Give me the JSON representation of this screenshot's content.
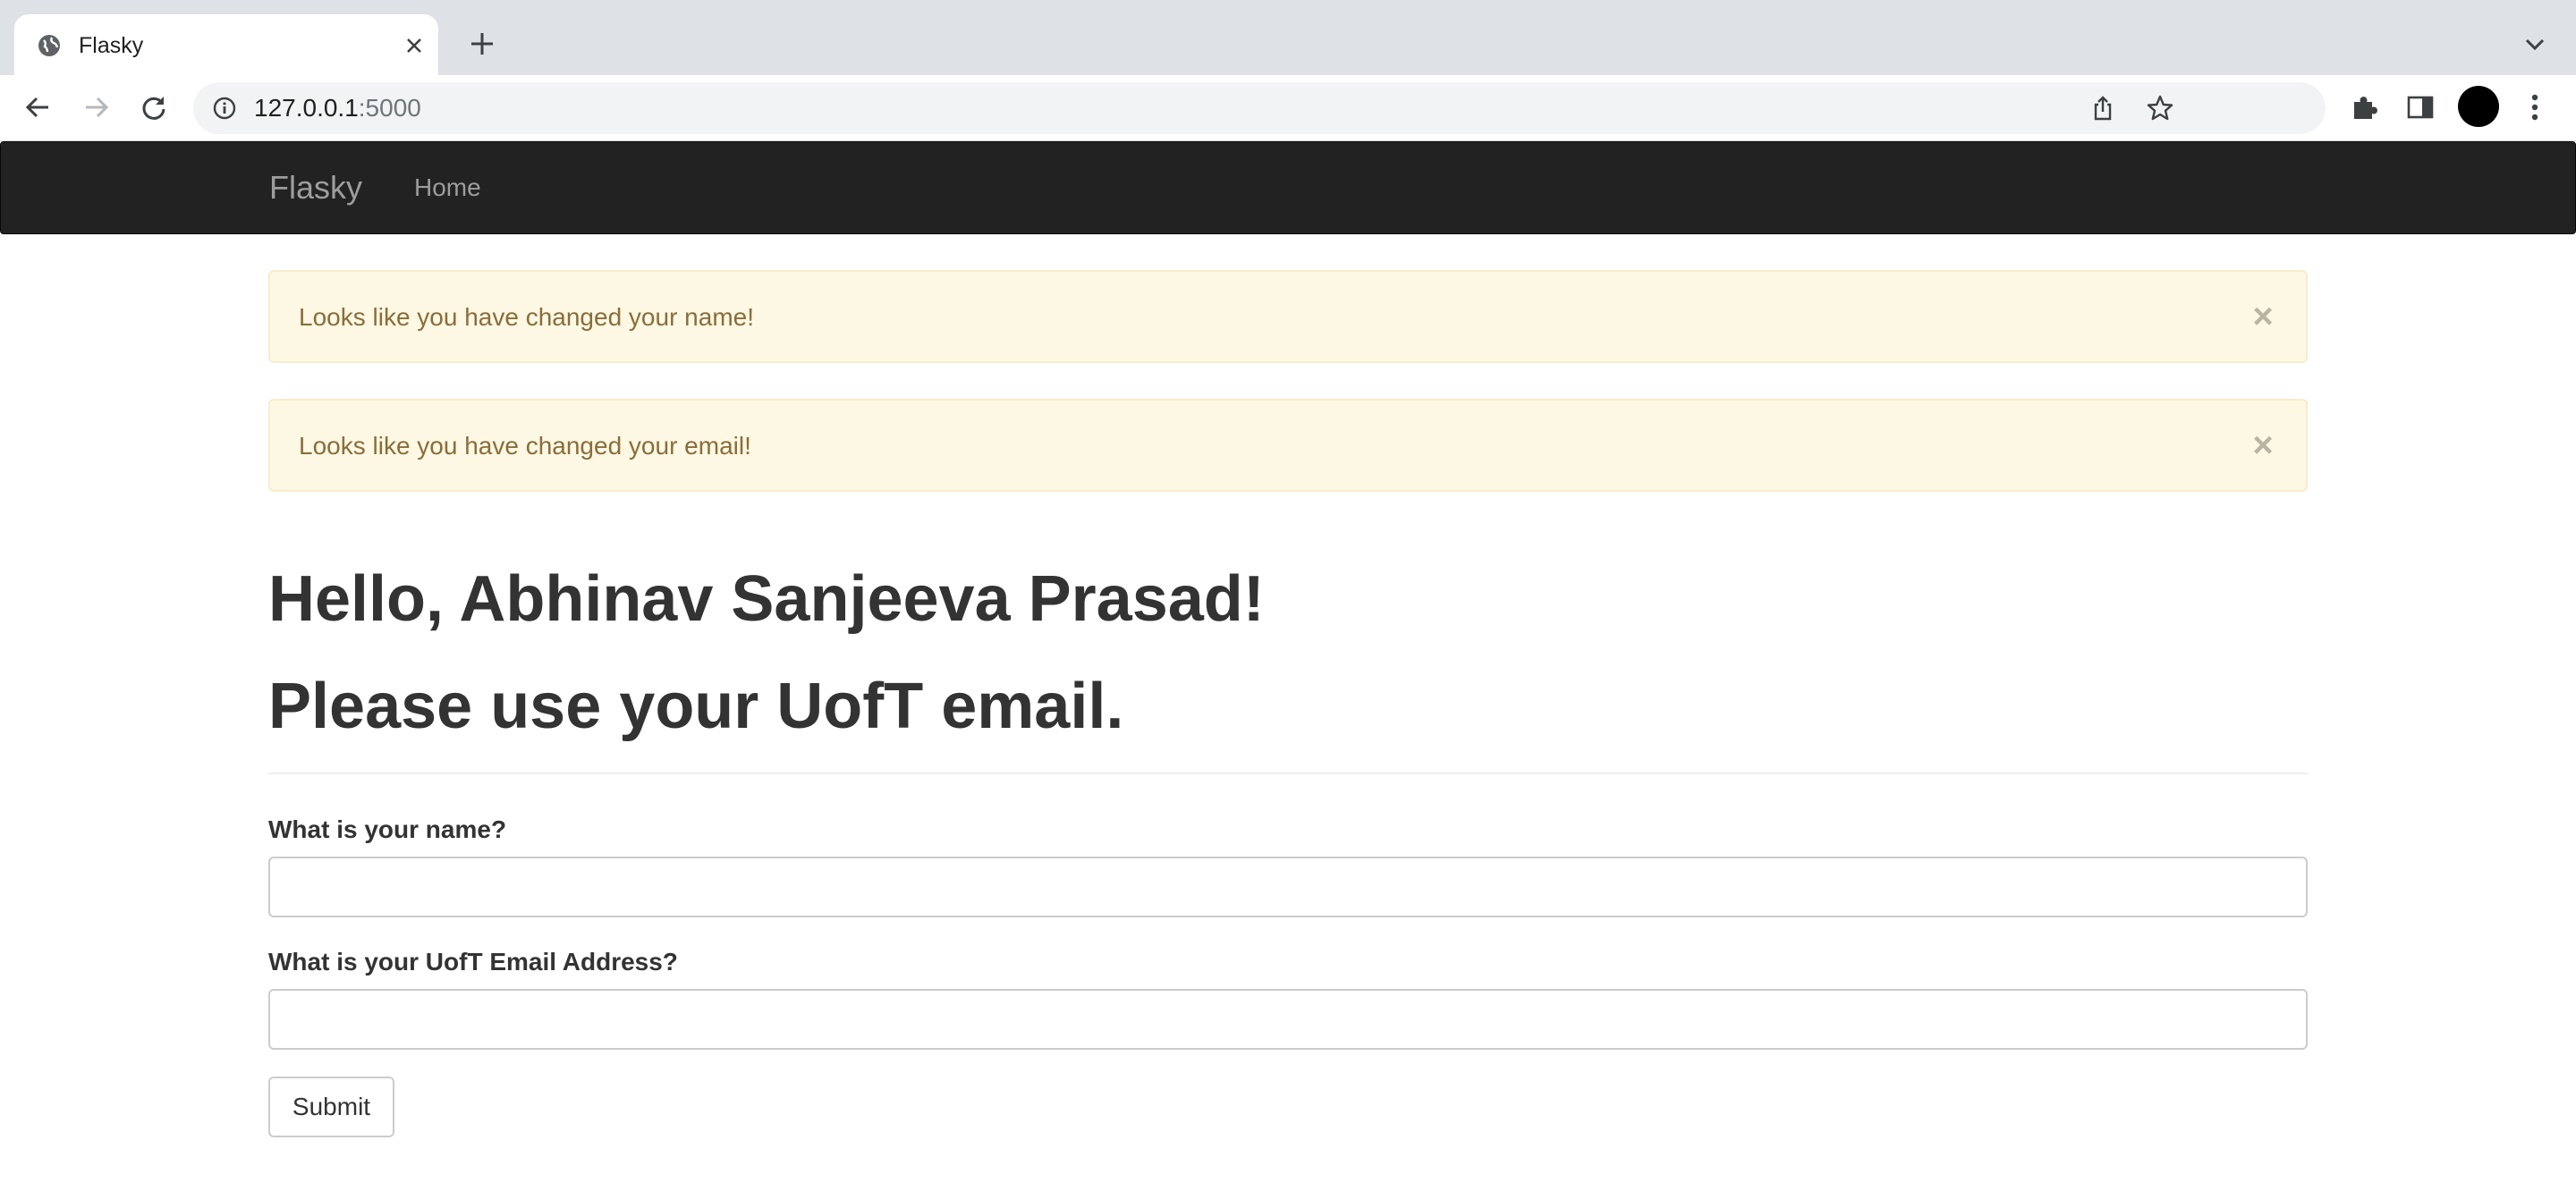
{
  "browser": {
    "tab_title": "Flasky",
    "url_host": "127.0.0.1",
    "url_port": ":5000",
    "icons": [
      "globe-icon",
      "close-icon",
      "plus-icon",
      "chevron-down-icon",
      "back-icon",
      "forward-icon",
      "reload-icon",
      "info-icon",
      "share-icon",
      "star-icon",
      "puzzle-icon",
      "side-panel-icon",
      "kebab-menu-icon"
    ]
  },
  "navbar": {
    "brand": "Flasky",
    "home": "Home"
  },
  "alerts": [
    {
      "text": "Looks like you have changed your name!",
      "close": "×"
    },
    {
      "text": "Looks like you have changed your email!",
      "close": "×"
    }
  ],
  "main": {
    "greeting": "Hello, Abhinav Sanjeeva Prasad!",
    "notice": "Please use your UofT email."
  },
  "form": {
    "name_label": "What is your name?",
    "name_value": "",
    "email_label": "What is your UofT Email Address?",
    "email_value": "",
    "submit_label": "Submit"
  },
  "colors": {
    "navbar_bg": "#222222",
    "alert_bg": "#fcf8e3",
    "alert_text": "#8a6d3b",
    "text": "#333333"
  }
}
